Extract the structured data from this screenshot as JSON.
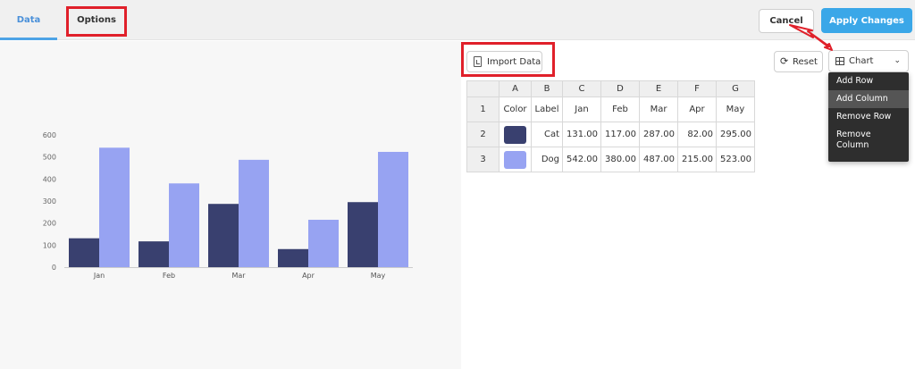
{
  "tabs": [
    {
      "label": "Data",
      "active": true
    },
    {
      "label": "Options",
      "active": false
    }
  ],
  "actions": {
    "cancel_label": "Cancel",
    "apply_label": "Apply Changes"
  },
  "toolbar": {
    "import_label": "Import Data",
    "reset_label": "Reset",
    "chart_select_label": "Chart"
  },
  "dropdown_menu": {
    "items": [
      "Add Row",
      "Add Column",
      "Remove Row",
      "Remove Column"
    ],
    "active_index": 1
  },
  "table": {
    "column_letters": [
      "A",
      "B",
      "C",
      "D",
      "E",
      "F",
      "G"
    ],
    "header_row_number": "1",
    "headers": [
      "Color",
      "Label",
      "Jan",
      "Feb",
      "Mar",
      "Apr",
      "May"
    ],
    "rows": [
      {
        "row_number": "2",
        "color": "#39406f",
        "label": "Cat",
        "values": [
          "131.00",
          "117.00",
          "287.00",
          "82.00",
          "295.00"
        ]
      },
      {
        "row_number": "3",
        "color": "#97a3f2",
        "label": "Dog",
        "values": [
          "542.00",
          "380.00",
          "487.00",
          "215.00",
          "523.00"
        ]
      }
    ]
  },
  "colors": {
    "accent": "#3aa7e8",
    "annotation": "#e0202a"
  },
  "chart_data": {
    "type": "bar",
    "categories": [
      "Jan",
      "Feb",
      "Mar",
      "Apr",
      "May"
    ],
    "series": [
      {
        "name": "Cat",
        "color": "#39406f",
        "values": [
          131,
          117,
          287,
          82,
          295
        ]
      },
      {
        "name": "Dog",
        "color": "#97a3f2",
        "values": [
          542,
          380,
          487,
          215,
          523
        ]
      }
    ],
    "ylim": [
      0,
      600
    ],
    "yticks": [
      0,
      100,
      200,
      300,
      400,
      500,
      600
    ],
    "grid": false,
    "legend": "none"
  }
}
